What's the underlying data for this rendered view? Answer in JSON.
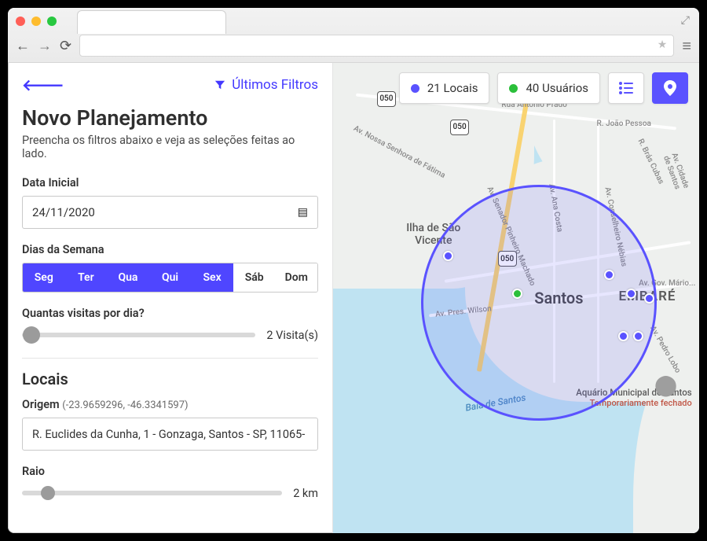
{
  "header": {
    "last_filters_label": "Últimos Filtros",
    "title": "Novo Planejamento",
    "subtitle": "Preencha os filtros abaixo e veja as seleções feitas ao lado."
  },
  "date": {
    "label": "Data Inicial",
    "value": "24/11/2020"
  },
  "weekdays": {
    "label": "Dias da Semana",
    "items": [
      {
        "short": "Seg",
        "selected": true
      },
      {
        "short": "Ter",
        "selected": true
      },
      {
        "short": "Qua",
        "selected": true
      },
      {
        "short": "Qui",
        "selected": true
      },
      {
        "short": "Sex",
        "selected": true
      },
      {
        "short": "Sáb",
        "selected": false
      },
      {
        "short": "Dom",
        "selected": false
      }
    ]
  },
  "visits": {
    "label": "Quantas visitas por dia?",
    "value_text": "2 Visita(s)",
    "value": 2,
    "thumb_pct": 4
  },
  "places": {
    "section_title": "Locais",
    "origin_label": "Origem",
    "origin_coords": "(-23.9659296, -46.3341597)",
    "origin_value": "R. Euclides da Cunha, 1 - Gonzaga, Santos - SP, 11065-",
    "radius_label": "Raio",
    "radius_value_text": "2 km",
    "radius_value": 2,
    "radius_thumb_pct": 10
  },
  "map": {
    "chip_locais": "21 Locais",
    "chip_usuarios": "40 Usuários",
    "city_label": "Santos",
    "embare_label": "EMBARÉ",
    "ilha_label_line1": "Ilha de São",
    "ilha_label_line2": "Vicente",
    "baia_label": "Baía de Santos",
    "poi_name": "Aquário Municipal de Santos",
    "poi_status": "Temporariamente fechado",
    "route_050": "050",
    "streets": {
      "antonio_prado": "Rua Antonio Prado",
      "joao_pessoa": "R. João Pessoa",
      "pres_wilson": "Av. Pres. Wilson",
      "bras_cubas": "R. Brás Cubas",
      "fatima": "Av. Nossa Senhora de Fátima",
      "senador": "Av. Senador Pinheiro Machado",
      "ana": "Av. Ana Costa",
      "conselheiro": "Av. Conselheiro Nébias",
      "cidade": "Av. Cidade de Santos",
      "gov": "Av. Gov. Mário...",
      "lobo": "Av. Pedro Lobo"
    }
  }
}
